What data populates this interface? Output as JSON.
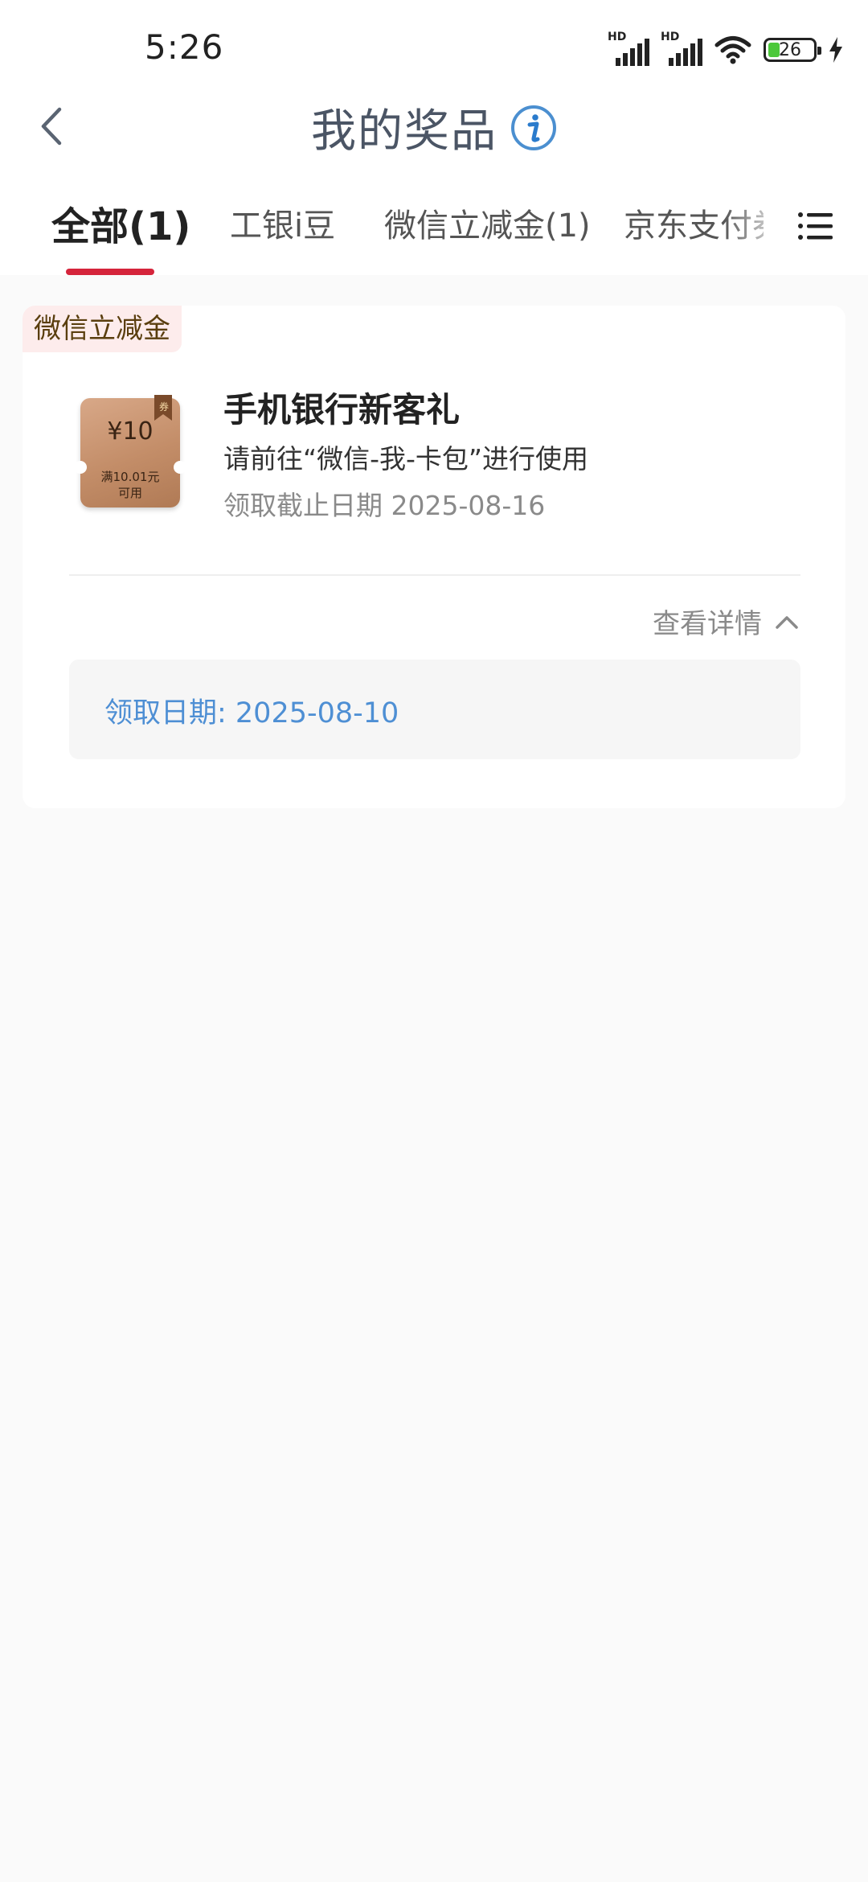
{
  "status_bar": {
    "time": "5:26",
    "signal1_label": "HD",
    "signal2_label": "HD",
    "battery_level": "26",
    "icons": [
      "signal-icon",
      "signal-icon",
      "wifi-icon",
      "battery-icon",
      "charging-icon"
    ]
  },
  "header": {
    "title": "我的奖品",
    "back_icon": "chevron-left-icon",
    "info_icon": "info-icon"
  },
  "tabs": [
    {
      "label": "全部(1)",
      "active": true
    },
    {
      "label": "工银i豆",
      "active": false
    },
    {
      "label": "微信立减金(1)",
      "active": false
    },
    {
      "label": "京东支付券",
      "active": false
    }
  ],
  "tabs_menu_icon": "list-icon",
  "accent_color": "#d5243b",
  "prize": {
    "category": "微信立减金",
    "coupon": {
      "value": "¥10",
      "condition_line1": "满10.01元",
      "condition_line2": "可用",
      "ribbon_label": "券"
    },
    "name": "手机银行新客礼",
    "description": "请前往“微信-我-卡包”进行使用",
    "deadline": "领取截止日期 2025-08-16",
    "details_toggle": "查看详情",
    "received_date": "领取日期: 2025-08-10"
  }
}
